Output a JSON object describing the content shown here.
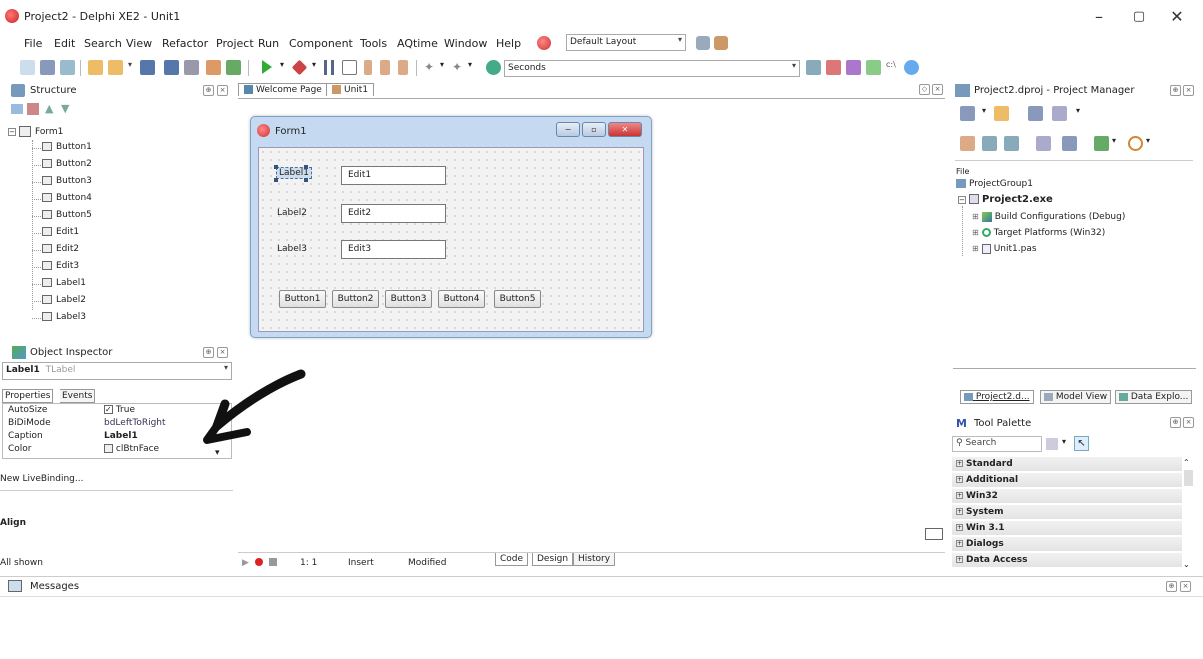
{
  "window": {
    "title": "Project2 - Delphi XE2 - Unit1",
    "minimize": "–",
    "restore": "▢",
    "close": "✕"
  },
  "menu": [
    "File",
    "Edit",
    "Search",
    "View",
    "Refactor",
    "Project",
    "Run",
    "Component",
    "Tools",
    "AQtime",
    "Window",
    "Help"
  ],
  "layout_combo": "Default Layout",
  "toolbar": {
    "seconds_combo": "Seconds"
  },
  "structure": {
    "title": "Structure",
    "root": "Form1",
    "items": [
      "Button1",
      "Button2",
      "Button3",
      "Button4",
      "Button5",
      "Edit1",
      "Edit2",
      "Edit3",
      "Label1",
      "Label2",
      "Label3"
    ]
  },
  "editor": {
    "tabs": [
      "Welcome Page",
      "Unit1"
    ],
    "form": {
      "caption": "Form1",
      "labels": [
        "Label1",
        "Label2",
        "Label3"
      ],
      "edits": [
        "Edit1",
        "Edit2",
        "Edit3"
      ],
      "buttons": [
        "Button1",
        "Button2",
        "Button3",
        "Button4",
        "Button5"
      ]
    },
    "status": {
      "position": "1:  1",
      "mode": "Insert",
      "state": "Modified"
    },
    "view_tabs": [
      "Code",
      "Design",
      "History"
    ]
  },
  "object_inspector": {
    "title": "Object Inspector",
    "selected_name": "Label1",
    "selected_type": "TLabel",
    "tabs": [
      "Properties",
      "Events"
    ],
    "properties": [
      {
        "name": "AutoSize",
        "value": "True"
      },
      {
        "name": "BiDiMode",
        "value": "bdLeftToRight"
      },
      {
        "name": "Caption",
        "value": "Label1"
      },
      {
        "name": "Color",
        "value": "clBtnFace"
      }
    ],
    "livebinding": "New LiveBinding...",
    "section": "Align",
    "footer": "All shown"
  },
  "project_manager": {
    "title": "Project2.dproj - Project Manager",
    "file_label": "File",
    "tree": {
      "group": "ProjectGroup1",
      "project": "Project2.exe",
      "children": [
        "Build Configurations (Debug)",
        "Target Platforms (Win32)",
        "Unit1.pas"
      ]
    },
    "tabs": [
      "Project2.d...",
      "Model View",
      "Data Explo..."
    ]
  },
  "tool_palette": {
    "title": "Tool Palette",
    "search_placeholder": "Search",
    "categories": [
      "Standard",
      "Additional",
      "Win32",
      "System",
      "Win 3.1",
      "Dialogs",
      "Data Access"
    ]
  },
  "messages": {
    "title": "Messages"
  }
}
